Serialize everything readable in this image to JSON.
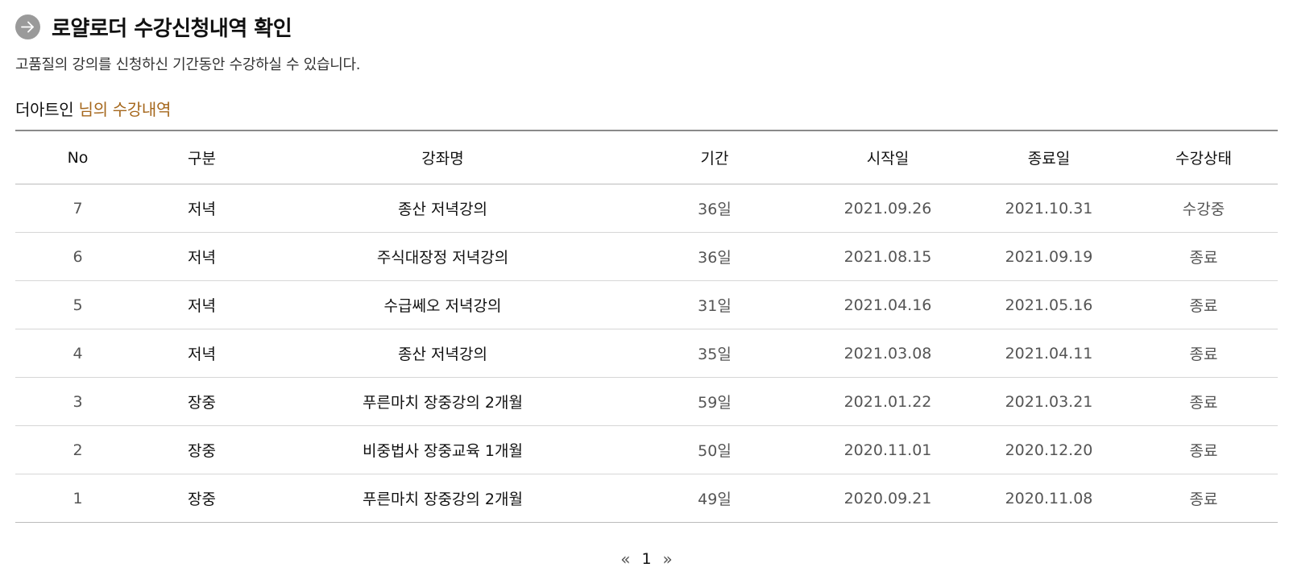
{
  "header": {
    "title": "로얄로더 수강신청내역 확인",
    "subtitle": "고품질의 강의를 신청하신 기간동안 수강하실 수 있습니다."
  },
  "section": {
    "user_name": "더아트인",
    "heading_suffix": "님의 수강내역"
  },
  "table": {
    "columns": [
      "No",
      "구분",
      "강좌명",
      "기간",
      "시작일",
      "종료일",
      "수강상태"
    ],
    "rows": [
      {
        "no": "7",
        "category": "저녁",
        "course": "종산 저녁강의",
        "period": "36일",
        "start": "2021.09.26",
        "end": "2021.10.31",
        "status": "수강중"
      },
      {
        "no": "6",
        "category": "저녁",
        "course": "주식대장정 저녁강의",
        "period": "36일",
        "start": "2021.08.15",
        "end": "2021.09.19",
        "status": "종료"
      },
      {
        "no": "5",
        "category": "저녁",
        "course": "수급쎄오 저녁강의",
        "period": "31일",
        "start": "2021.04.16",
        "end": "2021.05.16",
        "status": "종료"
      },
      {
        "no": "4",
        "category": "저녁",
        "course": "종산 저녁강의",
        "period": "35일",
        "start": "2021.03.08",
        "end": "2021.04.11",
        "status": "종료"
      },
      {
        "no": "3",
        "category": "장중",
        "course": "푸른마치 장중강의 2개월",
        "period": "59일",
        "start": "2021.01.22",
        "end": "2021.03.21",
        "status": "종료"
      },
      {
        "no": "2",
        "category": "장중",
        "course": "비중법사 장중교육 1개월",
        "period": "50일",
        "start": "2020.11.01",
        "end": "2020.12.20",
        "status": "종료"
      },
      {
        "no": "1",
        "category": "장중",
        "course": "푸른마치 장중강의 2개월",
        "period": "49일",
        "start": "2020.09.21",
        "end": "2020.11.08",
        "status": "종료"
      }
    ]
  },
  "pagination": {
    "prev_label": "«",
    "current_page": "1",
    "next_label": "»"
  },
  "colors": {
    "accent": "#a5671c",
    "badge": "#9a9a9a"
  },
  "icons": {
    "title_badge": "arrow-right-icon"
  }
}
